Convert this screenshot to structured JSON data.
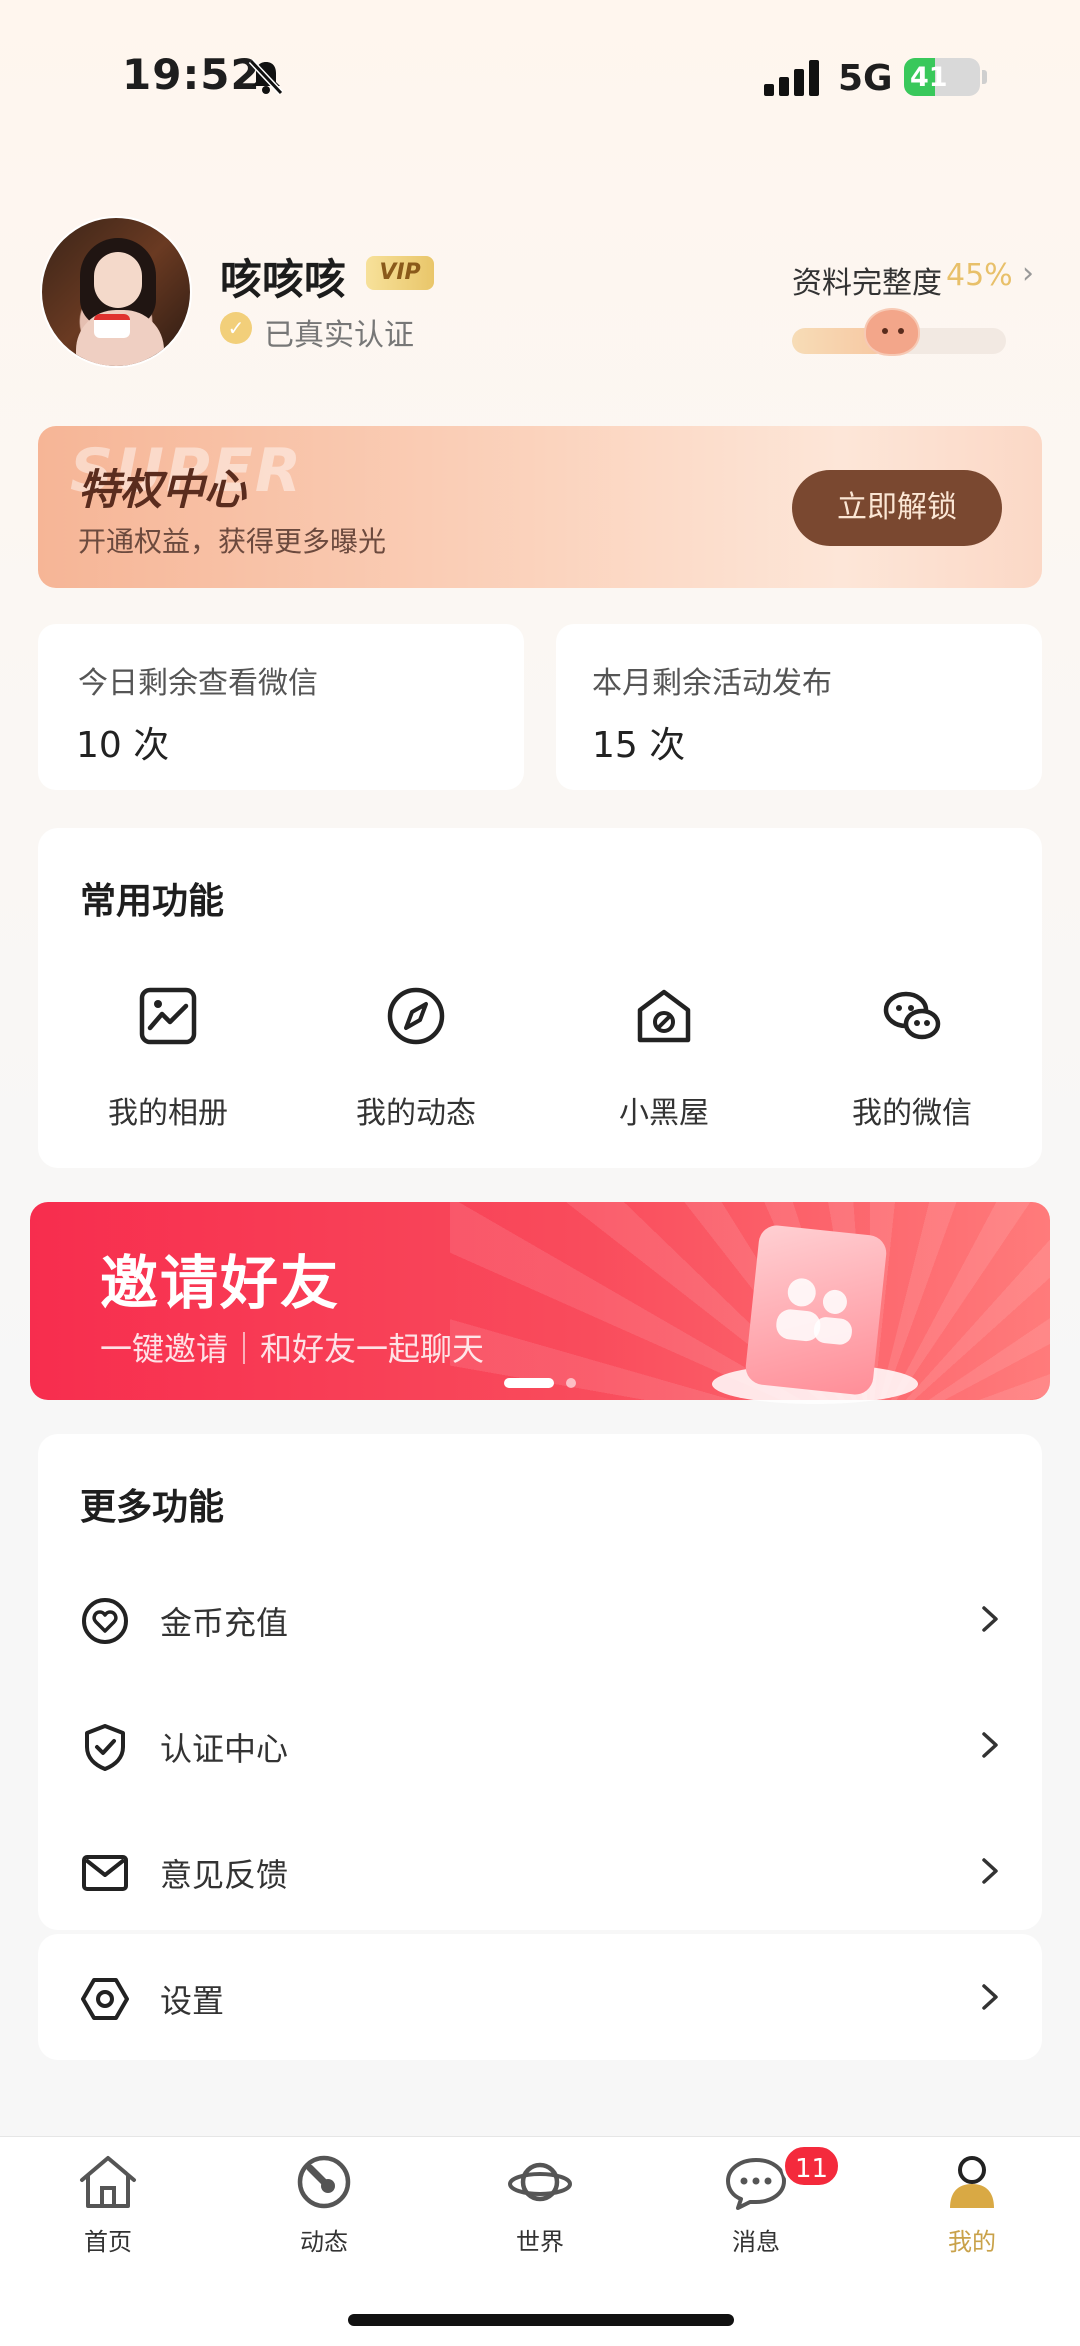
{
  "status_bar": {
    "time": "19:52",
    "network": "5G",
    "battery": "41",
    "battery_level": 0.41
  },
  "profile": {
    "nickname": "咳咳咳",
    "vip_badge": "VIP",
    "verified_text": "已真实认证",
    "completion_label": "资料完整度",
    "completion_percent": "45%",
    "completion_level": 0.45
  },
  "privilege": {
    "watermark": "SUPER",
    "title": "特权中心",
    "subtitle": "开通权益，获得更多曝光",
    "button": "立即解锁"
  },
  "stats": [
    {
      "label": "今日剩余查看微信",
      "value": "10 次"
    },
    {
      "label": "本月剩余活动发布",
      "value": "15 次"
    }
  ],
  "common_functions": {
    "title": "常用功能",
    "items": [
      {
        "label": "我的相册",
        "icon": "album-icon"
      },
      {
        "label": "我的动态",
        "icon": "compass-icon"
      },
      {
        "label": "小黑屋",
        "icon": "block-house-icon"
      },
      {
        "label": "我的微信",
        "icon": "wechat-icon"
      }
    ]
  },
  "invite_banner": {
    "title": "邀请好友",
    "subtitle": "一键邀请｜和好友一起聊天",
    "slide_count": 2,
    "active_slide": 1
  },
  "more_functions": {
    "title": "更多功能",
    "items": [
      {
        "label": "金币充值",
        "icon": "coin-heart-icon"
      },
      {
        "label": "认证中心",
        "icon": "shield-check-icon"
      },
      {
        "label": "意见反馈",
        "icon": "mail-icon"
      },
      {
        "label": "设置",
        "icon": "settings-icon"
      }
    ]
  },
  "tabbar": {
    "items": [
      {
        "label": "首页",
        "icon": "home-icon"
      },
      {
        "label": "动态",
        "icon": "feed-icon"
      },
      {
        "label": "世界",
        "icon": "planet-icon"
      },
      {
        "label": "消息",
        "icon": "message-icon",
        "badge": "11"
      },
      {
        "label": "我的",
        "icon": "profile-icon",
        "active": true
      }
    ]
  },
  "colors": {
    "accent_gold": "#e8c06a",
    "active_tab": "#c9a24a",
    "invite_red": "#f72d4e",
    "battery_green": "#39c85b",
    "badge_red": "#f42a3c"
  }
}
